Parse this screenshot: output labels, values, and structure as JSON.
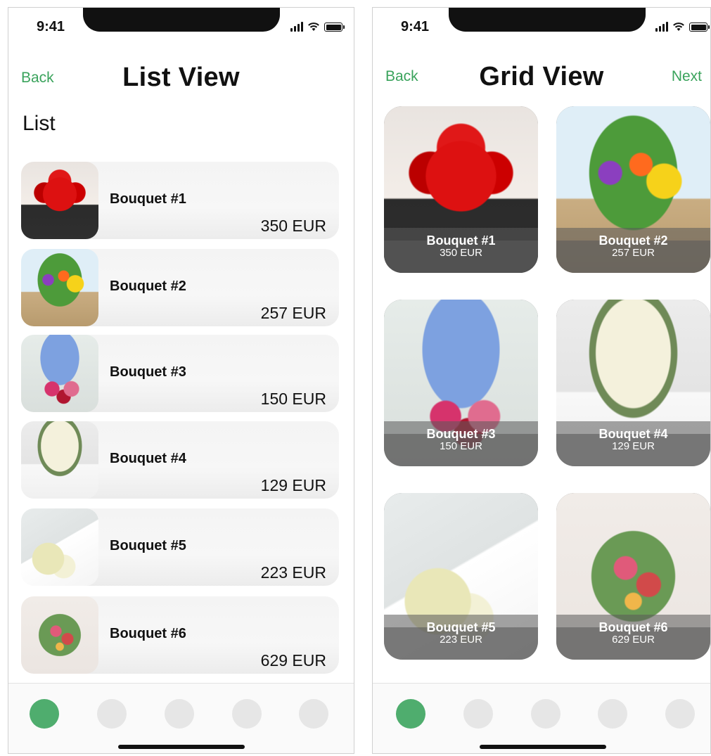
{
  "status_bar": {
    "time": "9:41"
  },
  "list_screen": {
    "back_label": "Back",
    "title": "List View",
    "section_title": "List",
    "items": [
      {
        "name": "Bouquet #1",
        "price": "350 EUR"
      },
      {
        "name": "Bouquet #2",
        "price": "257 EUR"
      },
      {
        "name": "Bouquet #3",
        "price": "150 EUR"
      },
      {
        "name": "Bouquet #4",
        "price": "129 EUR"
      },
      {
        "name": "Bouquet #5",
        "price": "223 EUR"
      },
      {
        "name": "Bouquet #6",
        "price": "629 EUR"
      }
    ]
  },
  "grid_screen": {
    "back_label": "Back",
    "title": "Grid View",
    "next_label": "Next",
    "items": [
      {
        "name": "Bouquet #1",
        "price": "350 EUR"
      },
      {
        "name": "Bouquet #2",
        "price": "257 EUR"
      },
      {
        "name": "Bouquet #3",
        "price": "150 EUR"
      },
      {
        "name": "Bouquet #4",
        "price": "129 EUR"
      },
      {
        "name": "Bouquet #5",
        "price": "223 EUR"
      },
      {
        "name": "Bouquet #6",
        "price": "629 EUR"
      }
    ]
  },
  "tab_bar": {
    "tab_count": 5,
    "active_index": 0
  },
  "colors": {
    "accent": "#3aa35c",
    "active_tab": "#4fad6e",
    "inactive_tab": "#e6e6e6"
  },
  "icons": [
    "cellular-signal-icon",
    "wifi-icon",
    "battery-icon",
    "bouquet-photo"
  ]
}
